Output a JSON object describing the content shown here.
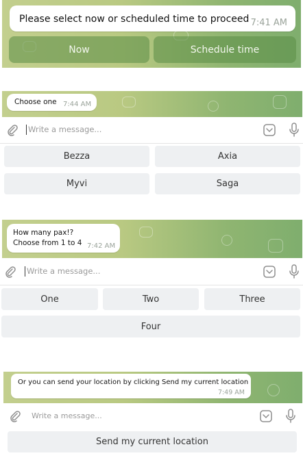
{
  "panel1": {
    "message": "Please select now or scheduled time to proceed",
    "time": "7:41 AM",
    "buttons": [
      "Now",
      "Schedule time"
    ]
  },
  "panel2": {
    "message": "Choose one",
    "time": "7:44 AM",
    "placeholder": "Write a message...",
    "buttons": [
      "Bezza",
      "Axia",
      "Myvi",
      "Saga"
    ]
  },
  "panel3": {
    "message_line1": "How many pax!?",
    "message_line2": "Choose from 1 to 4",
    "time": "7:42 AM",
    "placeholder": "Write a message...",
    "buttons": [
      "One",
      "Two",
      "Three",
      "Four"
    ]
  },
  "panel4": {
    "message": "Or you can send your location by clicking Send my current location",
    "time": "7:49 AM",
    "placeholder": "Write a message...",
    "button": "Send my current location"
  },
  "icons": [
    "attach-icon",
    "sticker-icon",
    "microphone-icon"
  ],
  "colors": {
    "chat_bg_start": "#c3cf8e",
    "chat_bg_end": "#7fae6e",
    "keyboard_button": "#eef0f2",
    "inline_button": "#5a8c46"
  }
}
